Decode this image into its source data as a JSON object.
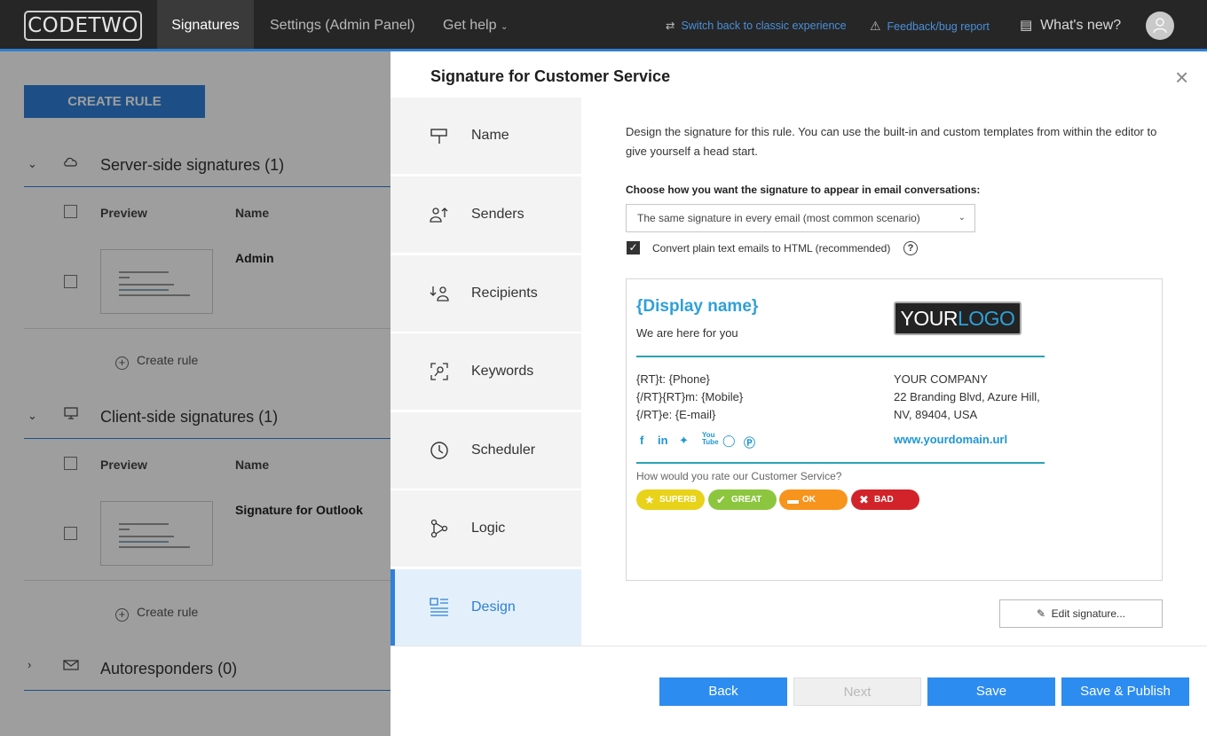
{
  "topbar": {
    "logo": "CODETWO",
    "nav": [
      "Signatures",
      "Settings (Admin Panel)",
      "Get help"
    ],
    "switch_classic": "Switch back to classic experience",
    "feedback": "Feedback/bug report",
    "whats_new": "What's new?"
  },
  "background": {
    "create_rule": "CREATE RULE",
    "server_section": "Server-side signatures (1)",
    "client_section": "Client-side signatures (1)",
    "autoresponders": "Autoresponders (0)",
    "col_preview": "Preview",
    "col_name": "Name",
    "server_row_name": "Admin",
    "client_row_name": "Signature for Outlook",
    "create_rule_link": "Create rule"
  },
  "panel": {
    "title": "Signature for Customer Service",
    "steps": [
      {
        "label": "Name",
        "icon": "signpost-icon"
      },
      {
        "label": "Senders",
        "icon": "senders-icon"
      },
      {
        "label": "Recipients",
        "icon": "recipients-icon"
      },
      {
        "label": "Keywords",
        "icon": "keywords-icon"
      },
      {
        "label": "Scheduler",
        "icon": "clock-icon"
      },
      {
        "label": "Logic",
        "icon": "logic-icon"
      },
      {
        "label": "Design",
        "icon": "design-icon"
      }
    ],
    "active_step": "Design",
    "description": "Design the signature for this rule. You can use the built-in and custom templates from within the editor to give yourself a head start.",
    "choose_label": "Choose how you want the signature to appear in email conversations:",
    "select_value": "The same signature in every email (most common scenario)",
    "convert_label": "Convert plain text emails to HTML (recommended)",
    "convert_checked": true,
    "edit_signature": "Edit signature...",
    "buttons": {
      "back": "Back",
      "next": "Next",
      "save": "Save",
      "save_publish": "Save & Publish"
    }
  },
  "signature": {
    "display_name": "{Display name}",
    "tagline": "We are here for you",
    "logo_left": "YOUR",
    "logo_right": "LOGO",
    "phone": "{RT}t: {Phone}",
    "mobile": "{/RT}{RT}m: {Mobile}",
    "email": "{/RT}e: {E-mail}",
    "company": "YOUR COMPANY",
    "address1": "22 Branding Blvd, Azure Hill,",
    "address2": "NV, 89404, USA",
    "url": "www.yourdomain.url",
    "rate_question": "How would you rate our Customer Service?",
    "ratings": [
      {
        "label": "SUPERB",
        "color": "#e8d21a"
      },
      {
        "label": "GREAT",
        "color": "#8cc63f"
      },
      {
        "label": "OK",
        "color": "#f7941d"
      },
      {
        "label": "BAD",
        "color": "#d2232a"
      }
    ]
  }
}
